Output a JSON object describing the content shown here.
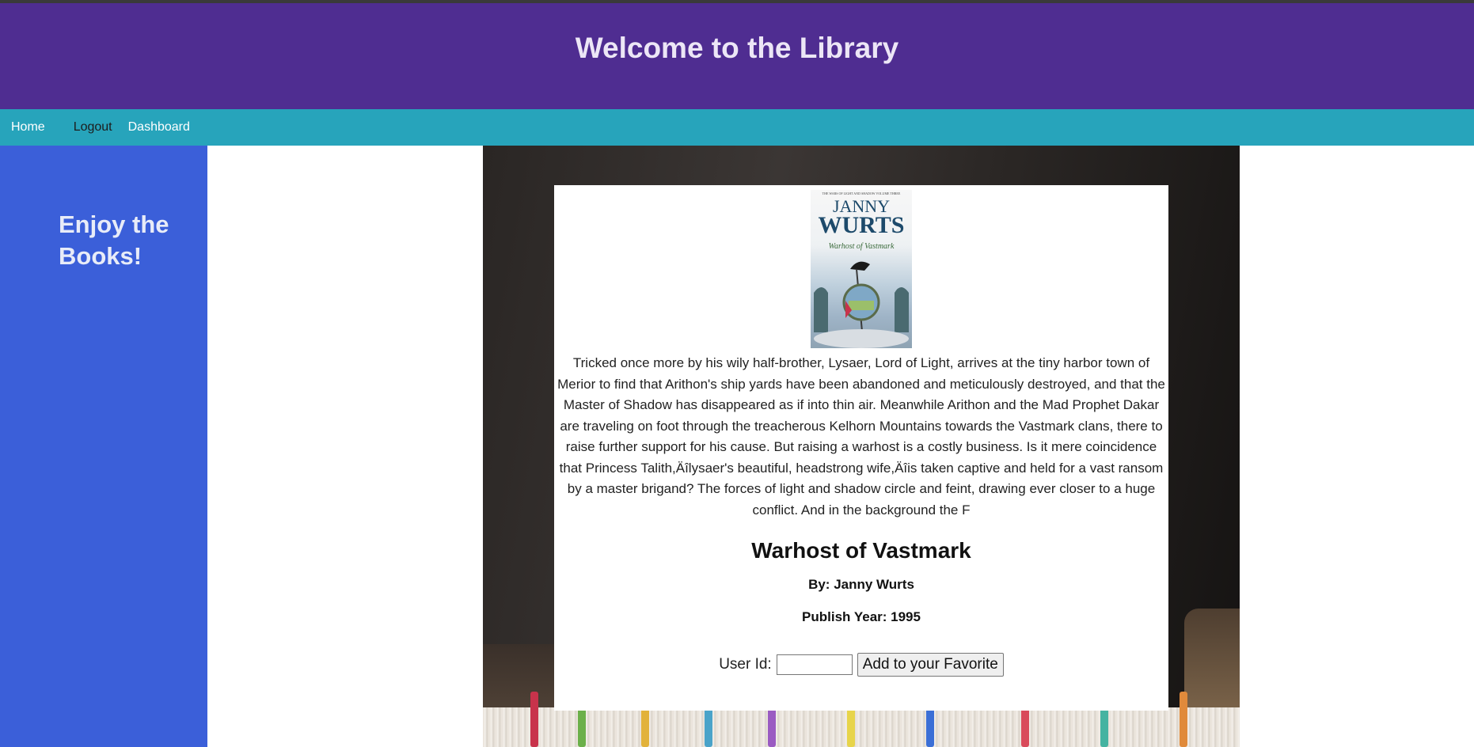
{
  "header": {
    "title": "Welcome to the Library"
  },
  "nav": {
    "home": "Home",
    "logout": "Logout",
    "dashboard": "Dashboard"
  },
  "sidebar": {
    "slogan": "Enjoy the Books!"
  },
  "book": {
    "cover": {
      "series_line": "THE WARS OF LIGHT AND SHADOW VOLUME THREE",
      "author_first": "JANNY",
      "author_last": "WURTS",
      "title": "Warhost of Vastmark"
    },
    "description": "Tricked once more by his wily half-brother, Lysaer, Lord of Light, arrives at the tiny harbor town of Merior to find that Arithon's ship yards have been abandoned and meticulously destroyed, and that the Master of Shadow has disappeared as if into thin air. Meanwhile Arithon and the Mad Prophet Dakar are traveling on foot through the treacherous Kelhorn Mountains towards the Vastmark clans, there to raise further support for his cause. But raising a warhost is a costly business. Is it mere coincidence that Princess Talith,Äîlysaer's beautiful, headstrong wife,Äîis taken captive and held for a vast ransom by a master brigand? The forces of light and shadow circle and feint, drawing ever closer to a huge conflict. And in the background the F",
    "title": "Warhost of Vastmark",
    "author_line": "By: Janny Wurts",
    "year_line": "Publish Year: 1995"
  },
  "favorite": {
    "label": "User Id:",
    "input_value": "",
    "button_label": "Add to your Favorite"
  },
  "colors": {
    "header_bg": "#4f2d91",
    "nav_bg": "#27a4bb",
    "sidebar_bg": "#3b5fd9"
  }
}
